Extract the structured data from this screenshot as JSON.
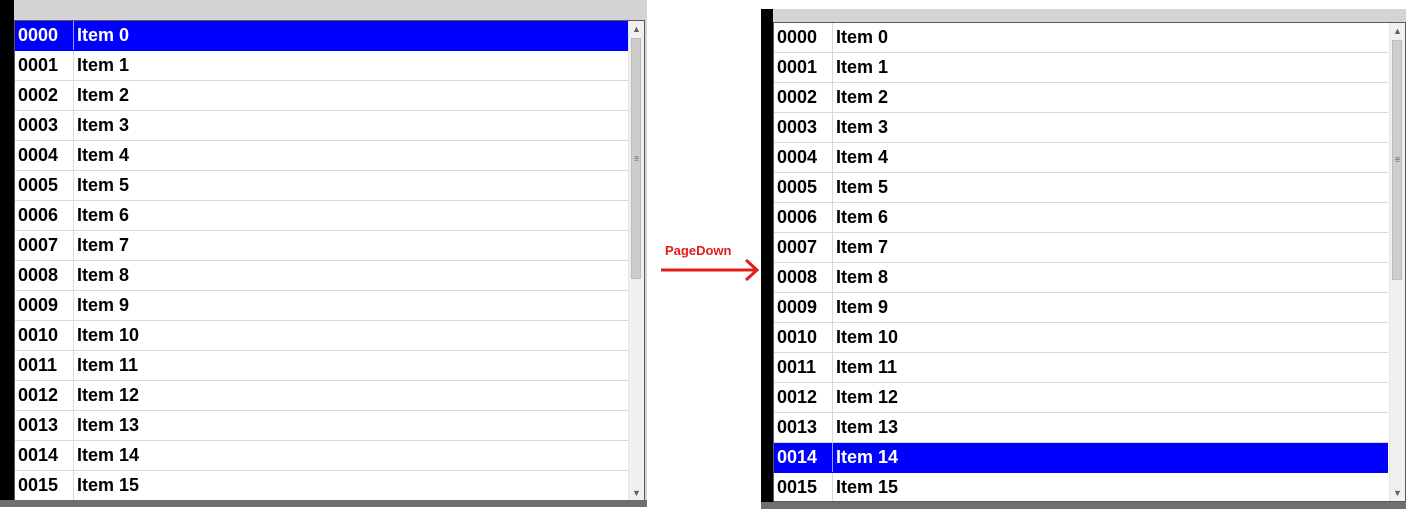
{
  "before_panel": {
    "rows": [
      {
        "num": "0000",
        "name": "Item 0"
      },
      {
        "num": "0001",
        "name": "Item 1"
      },
      {
        "num": "0002",
        "name": "Item 2"
      },
      {
        "num": "0003",
        "name": "Item 3"
      },
      {
        "num": "0004",
        "name": "Item 4"
      },
      {
        "num": "0005",
        "name": "Item 5"
      },
      {
        "num": "0006",
        "name": "Item 6"
      },
      {
        "num": "0007",
        "name": "Item 7"
      },
      {
        "num": "0008",
        "name": "Item 8"
      },
      {
        "num": "0009",
        "name": "Item 9"
      },
      {
        "num": "0010",
        "name": "Item 10"
      },
      {
        "num": "0011",
        "name": "Item 11"
      },
      {
        "num": "0012",
        "name": "Item 12"
      },
      {
        "num": "0013",
        "name": "Item 13"
      },
      {
        "num": "0014",
        "name": "Item 14"
      },
      {
        "num": "0015",
        "name": "Item 15"
      }
    ],
    "selected_index": 0
  },
  "transition": {
    "label": "PageDown",
    "arrow_color": "#e31b1b"
  },
  "after_panel": {
    "rows": [
      {
        "num": "0000",
        "name": "Item 0"
      },
      {
        "num": "0001",
        "name": "Item 1"
      },
      {
        "num": "0002",
        "name": "Item 2"
      },
      {
        "num": "0003",
        "name": "Item 3"
      },
      {
        "num": "0004",
        "name": "Item 4"
      },
      {
        "num": "0005",
        "name": "Item 5"
      },
      {
        "num": "0006",
        "name": "Item 6"
      },
      {
        "num": "0007",
        "name": "Item 7"
      },
      {
        "num": "0008",
        "name": "Item 8"
      },
      {
        "num": "0009",
        "name": "Item 9"
      },
      {
        "num": "0010",
        "name": "Item 10"
      },
      {
        "num": "0011",
        "name": "Item 11"
      },
      {
        "num": "0012",
        "name": "Item 12"
      },
      {
        "num": "0013",
        "name": "Item 13"
      },
      {
        "num": "0014",
        "name": "Item 14"
      },
      {
        "num": "0015",
        "name": "Item 15"
      }
    ],
    "selected_index": 14
  },
  "colors": {
    "selection": "#0000ff",
    "selection_text": "#ffffff"
  },
  "icons": {
    "scroll_up": "scroll-up-arrow-icon",
    "scroll_down": "scroll-down-arrow-icon",
    "thumb_grip": "scroll-thumb-grip-icon",
    "transition_arrow": "right-arrow-icon"
  }
}
